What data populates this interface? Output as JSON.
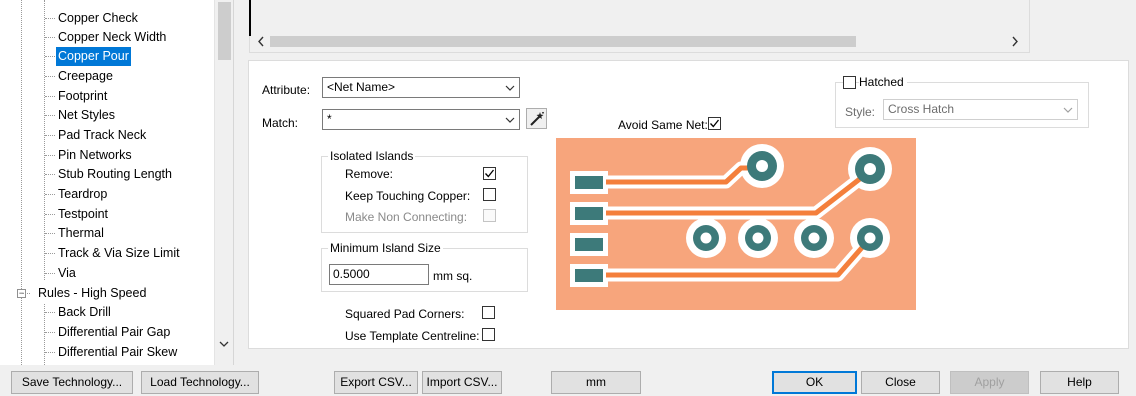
{
  "tree": {
    "items": [
      {
        "label": "Copper Check",
        "selected": false
      },
      {
        "label": "Copper Neck Width",
        "selected": false
      },
      {
        "label": "Copper Pour",
        "selected": true
      },
      {
        "label": "Creepage",
        "selected": false
      },
      {
        "label": "Footprint",
        "selected": false
      },
      {
        "label": "Net Styles",
        "selected": false
      },
      {
        "label": "Pad Track Neck",
        "selected": false
      },
      {
        "label": "Pin Networks",
        "selected": false
      },
      {
        "label": "Stub Routing Length",
        "selected": false
      },
      {
        "label": "Teardrop",
        "selected": false
      },
      {
        "label": "Testpoint",
        "selected": false
      },
      {
        "label": "Thermal",
        "selected": false
      },
      {
        "label": "Track & Via Size Limit",
        "selected": false
      },
      {
        "label": "Via",
        "selected": false
      }
    ],
    "group": {
      "label": "Rules - High Speed",
      "expander": "−"
    },
    "sub_items": [
      {
        "label": "Back Drill"
      },
      {
        "label": "Differential Pair Gap"
      },
      {
        "label": "Differential Pair Skew"
      }
    ],
    "scroll_down_icon": "chevron-down-icon"
  },
  "preview": {
    "left_arrow": "‹",
    "right_arrow": "›"
  },
  "form": {
    "attribute_label": "Attribute:",
    "attribute_value": "<Net Name>",
    "match_label": "Match:",
    "match_value": "*",
    "match_button_icon": "wand-icon",
    "avoid_same_net_label": "Avoid Same Net:",
    "avoid_same_net_checked": true,
    "hatched_label": "Hatched",
    "hatched_checked": false,
    "style_label": "Style:",
    "style_value": "Cross Hatch",
    "isolated_islands": {
      "title": "Isolated Islands",
      "remove_label": "Remove:",
      "remove_checked": true,
      "keep_touching_label": "Keep Touching Copper:",
      "keep_touching_checked": false,
      "make_non_connecting_label": "Make Non Connecting:",
      "make_non_connecting_checked": false
    },
    "min_island": {
      "title": "Minimum Island Size",
      "value": "0.5000",
      "unit": "mm sq."
    },
    "squared_pad_label": "Squared Pad Corners:",
    "squared_pad_checked": false,
    "template_centreline_label": "Use Template Centreline:",
    "template_centreline_checked": false
  },
  "colors": {
    "copper_pour": "#f7a57c",
    "pad_teal": "#3d7a7a",
    "trace_orange": "#f47f3c",
    "selection_blue": "#0078d7"
  },
  "buttons": {
    "save_technology": "Save Technology...",
    "load_technology": "Load Technology...",
    "export_csv": "Export CSV...",
    "import_csv": "Import CSV...",
    "units": "mm",
    "ok": "OK",
    "close": "Close",
    "apply": "Apply",
    "help": "Help"
  }
}
